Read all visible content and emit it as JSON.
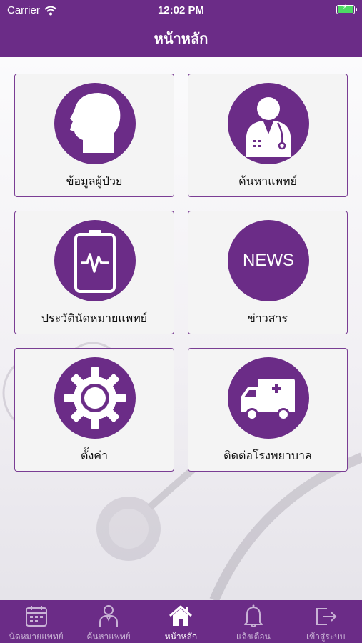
{
  "status_bar": {
    "carrier": "Carrier",
    "time": "12:02 PM",
    "wifi_icon": "wifi-icon",
    "battery_icon": "battery-charging-icon"
  },
  "header": {
    "title": "หน้าหลัก"
  },
  "tiles": [
    {
      "label": "ข้อมูลผู้ป่วย",
      "icon": "patient-head-icon"
    },
    {
      "label": "ค้นหาแพทย์",
      "icon": "doctor-icon"
    },
    {
      "label": "ประวัตินัดหมายแพทย์",
      "icon": "monitor-history-icon"
    },
    {
      "label": "ข่าวสาร",
      "icon": "news-icon",
      "icon_text": "NEWS"
    },
    {
      "label": "ตั้งค่า",
      "icon": "gear-icon"
    },
    {
      "label": "ติดต่อโรงพยาบาล",
      "icon": "ambulance-icon"
    }
  ],
  "tabbar": {
    "active": "หน้าหลัก",
    "items": [
      {
        "label": "นัดหมายแพทย์",
        "icon": "calendar-icon"
      },
      {
        "label": "ค้นหาแพทย์",
        "icon": "doctor-icon"
      },
      {
        "label": "หน้าหลัก",
        "icon": "home-icon"
      },
      {
        "label": "แจ้งเตือน",
        "icon": "bell-icon"
      },
      {
        "label": "เข้าสู่ระบบ",
        "icon": "login-icon"
      }
    ]
  },
  "colors": {
    "brand": "#6b2c87",
    "tile_border": "#7a3d94",
    "tile_bg": "#f4f4f4",
    "tab_inactive": "#c9b3d6",
    "battery": "#4cd964"
  }
}
